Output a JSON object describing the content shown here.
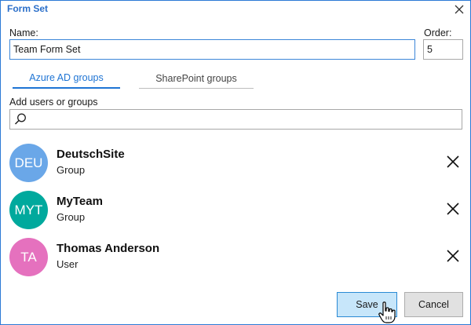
{
  "window": {
    "title": "Form Set"
  },
  "form": {
    "name_label": "Name:",
    "name_value": "Team Form Set",
    "order_label": "Order:",
    "order_value": "5"
  },
  "tabs": [
    {
      "label": "Azure AD groups",
      "active": true
    },
    {
      "label": "SharePoint groups",
      "active": false
    }
  ],
  "add_section": {
    "label": "Add users or groups",
    "search_value": ""
  },
  "entries": [
    {
      "initials": "DEU",
      "name": "DeutschSite",
      "type": "Group",
      "color": "#6aa7e8"
    },
    {
      "initials": "MYT",
      "name": "MyTeam",
      "type": "Group",
      "color": "#00a99d"
    },
    {
      "initials": "TA",
      "name": "Thomas Anderson",
      "type": "User",
      "color": "#e571be"
    }
  ],
  "buttons": {
    "save": "Save",
    "cancel": "Cancel"
  },
  "colors": {
    "accent": "#1e74d4",
    "save_bg": "#c7e6fa"
  }
}
